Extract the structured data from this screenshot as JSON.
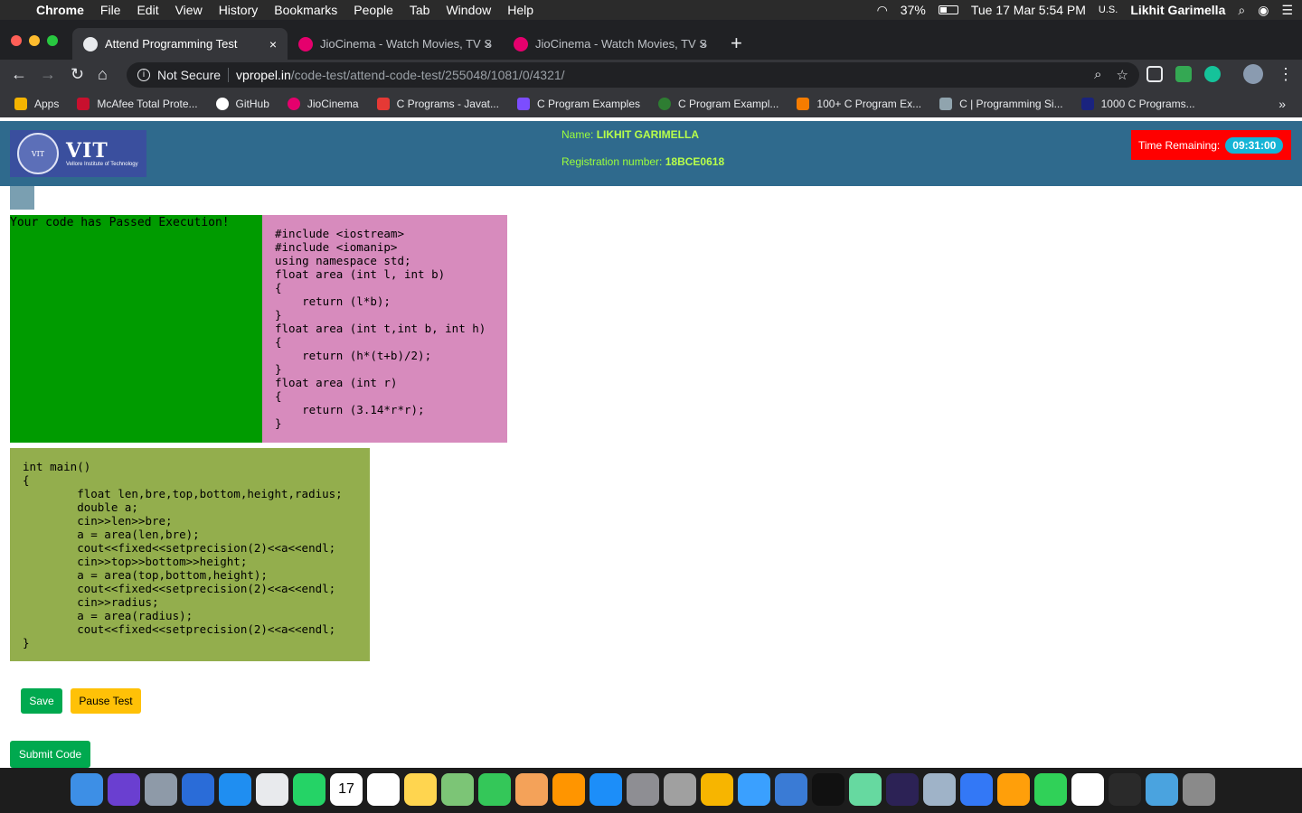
{
  "menubar": {
    "app": "Chrome",
    "items": [
      "File",
      "Edit",
      "View",
      "History",
      "Bookmarks",
      "People",
      "Tab",
      "Window",
      "Help"
    ],
    "battery": "37%",
    "datetime": "Tue 17 Mar  5:54 PM",
    "input_source": "U.S.",
    "user": "Likhit Garimella"
  },
  "tabs": [
    {
      "title": "Attend Programming Test",
      "close": "×",
      "favicon": "vpropel-icon"
    },
    {
      "title": "JioCinema - Watch Movies, TV S",
      "close": "×",
      "favicon": "jiocinema-icon"
    },
    {
      "title": "JioCinema - Watch Movies, TV S",
      "close": "×",
      "favicon": "jiocinema-icon"
    }
  ],
  "new_tab": "+",
  "address": {
    "security": "Not Secure",
    "host": "vpropel.in",
    "path": "/code-test/attend-code-test/255048/1081/0/4321/"
  },
  "bookmarks": {
    "items": [
      {
        "label": "Apps",
        "color": "#f4b400"
      },
      {
        "label": "McAfee Total Prote...",
        "color": "#c8102e"
      },
      {
        "label": "GitHub",
        "color": "#ffffff"
      },
      {
        "label": "JioCinema",
        "color": "#e5006d"
      },
      {
        "label": "C Programs - Javat...",
        "color": "#e53935"
      },
      {
        "label": "C Program Examples",
        "color": "#7c4dff"
      },
      {
        "label": "C Program Exampl...",
        "color": "#2e7d32"
      },
      {
        "label": "100+ C Program Ex...",
        "color": "#f57c00"
      },
      {
        "label": "C | Programming Si...",
        "color": "#90a4ae"
      },
      {
        "label": "1000 C Programs...",
        "color": "#1a237e"
      }
    ],
    "more": "»"
  },
  "header": {
    "logo_text": "VIT",
    "logo_subtext": "Vellore Institute of Technology",
    "seal_text": "VIT",
    "name_label": "Name:",
    "name_value": "LIKHIT GARIMELLA",
    "reg_label": "Registration number:",
    "reg_value": "18BCE0618",
    "timer_label": "Time Remaining:",
    "timer_value": "09:31:00"
  },
  "result": {
    "message": "Your code has Passed Execution!"
  },
  "code": {
    "prefix": "#include <iostream>\n#include <iomanip>\nusing namespace std;\nfloat area (int l, int b)\n{\n    return (l*b);\n}\nfloat area (int t,int b, int h)\n{\n    return (h*(t+b)/2);\n}\nfloat area (int r)\n{\n    return (3.14*r*r);\n}",
    "main": "int main()\n{\n        float len,bre,top,bottom,height,radius;\n        double a;\n        cin>>len>>bre;\n        a = area(len,bre);\n        cout<<fixed<<setprecision(2)<<a<<endl;\n        cin>>top>>bottom>>height;\n        a = area(top,bottom,height);\n        cout<<fixed<<setprecision(2)<<a<<endl;\n        cin>>radius;\n        a = area(radius);\n        cout<<fixed<<setprecision(2)<<a<<endl;\n}"
  },
  "buttons": {
    "save": "Save",
    "pause": "Pause Test",
    "submit": "Submit Code"
  },
  "dock": {
    "apps": [
      "finder",
      "siri",
      "launchpad",
      "bluetooth",
      "safari",
      "chrome",
      "whatsapp",
      "calendar",
      "reminders",
      "notes",
      "maps",
      "facetime",
      "photos",
      "books",
      "app-store",
      "system-preferences",
      "script-editor",
      "sketch",
      "xcode",
      "simulator",
      "terminal",
      "atom",
      "eclipse",
      "preview",
      "keynote",
      "pages",
      "numbers",
      "textedit",
      "activity-monitor",
      "downloads",
      "trash"
    ],
    "calendar_day": "17"
  }
}
